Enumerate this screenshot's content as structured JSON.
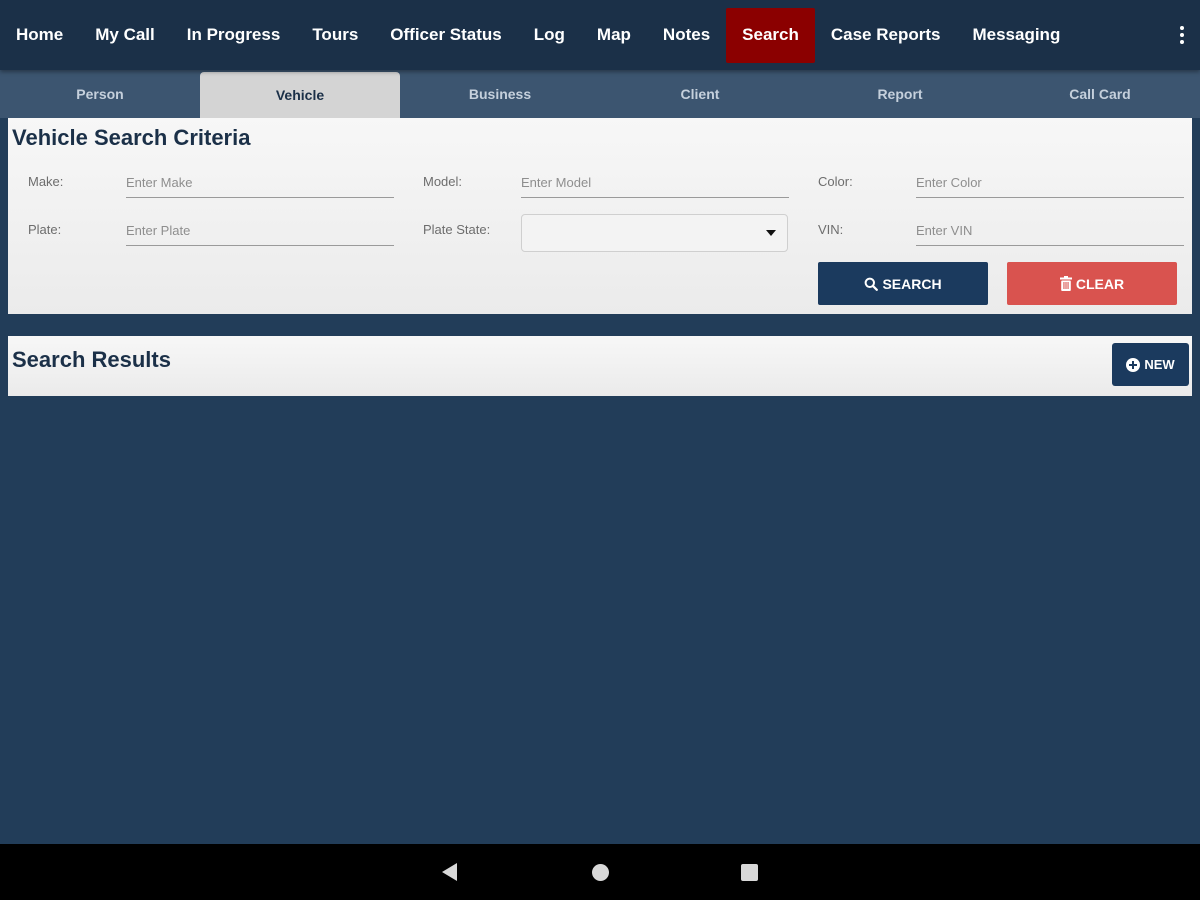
{
  "nav": {
    "items": [
      {
        "label": "Home",
        "active": false
      },
      {
        "label": "My Call",
        "active": false
      },
      {
        "label": "In Progress",
        "active": false
      },
      {
        "label": "Tours",
        "active": false
      },
      {
        "label": "Officer Status",
        "active": false
      },
      {
        "label": "Log",
        "active": false
      },
      {
        "label": "Map",
        "active": false
      },
      {
        "label": "Notes",
        "active": false
      },
      {
        "label": "Search",
        "active": true
      },
      {
        "label": "Case Reports",
        "active": false
      },
      {
        "label": "Messaging",
        "active": false
      }
    ],
    "more_icon": "more-vertical-icon"
  },
  "tabs": {
    "items": [
      {
        "label": "Person",
        "active": false
      },
      {
        "label": "Vehicle",
        "active": true
      },
      {
        "label": "Business",
        "active": false
      },
      {
        "label": "Client",
        "active": false
      },
      {
        "label": "Report",
        "active": false
      },
      {
        "label": "Call Card",
        "active": false
      }
    ]
  },
  "criteria": {
    "title": "Vehicle Search Criteria",
    "fields": {
      "make": {
        "label": "Make:",
        "placeholder": "Enter Make",
        "value": ""
      },
      "model": {
        "label": "Model:",
        "placeholder": "Enter Model",
        "value": ""
      },
      "color": {
        "label": "Color:",
        "placeholder": "Enter Color",
        "value": ""
      },
      "plate": {
        "label": "Plate:",
        "placeholder": "Enter Plate",
        "value": ""
      },
      "plate_state": {
        "label": "Plate State:",
        "value": ""
      },
      "vin": {
        "label": "VIN:",
        "placeholder": "Enter VIN",
        "value": ""
      }
    },
    "search_button": {
      "label": "SEARCH",
      "icon": "search-icon"
    },
    "clear_button": {
      "label": "CLEAR",
      "icon": "trash-icon"
    }
  },
  "results": {
    "title": "Search Results",
    "new_button": {
      "label": "NEW",
      "icon": "plus-circle-icon"
    }
  },
  "colors": {
    "nav_bg": "#1b3048",
    "active_nav": "#8b0000",
    "page_bg": "#223d59",
    "button_primary": "#1b3a5e",
    "button_danger": "#d9534f"
  }
}
